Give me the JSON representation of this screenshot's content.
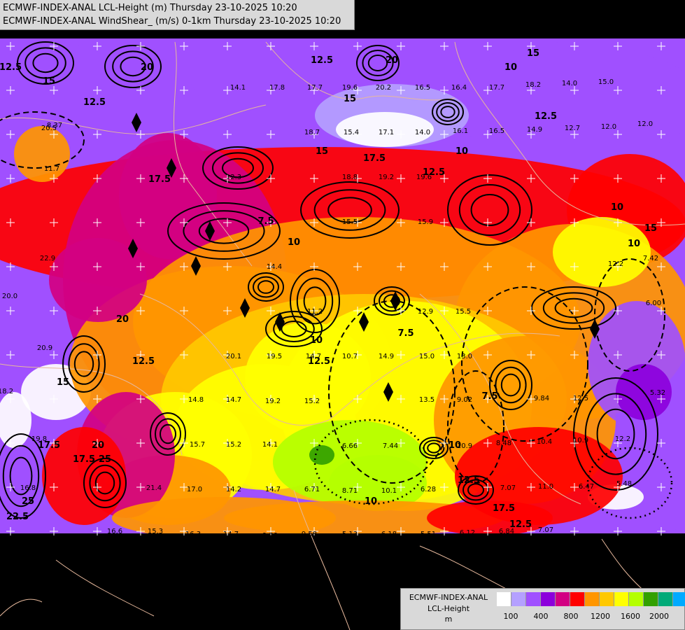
{
  "header": {
    "line1": "ECMWF-INDEX-ANAL LCL-Height (m) Thursday 23-10-2025 10:20",
    "line2": "ECMWF-INDEX-ANAL WindShear_ (m/s) 0-1km Thursday 23-10-2025 10:20"
  },
  "legend": {
    "line1": "ECMWF-INDEX-ANAL",
    "line2": "LCL-Height",
    "line3": "m",
    "colors": [
      "#ffffff",
      "#b4a0ff",
      "#a050ff",
      "#8c00dc",
      "#d20082",
      "#ff0000",
      "#ff9600",
      "#ffc800",
      "#ffff00",
      "#b4ff00",
      "#32a000",
      "#00aa78",
      "#00aaff"
    ],
    "tick_labels": [
      "100",
      "400",
      "800",
      "1200",
      "1600",
      "2000"
    ]
  },
  "contour_labels": {
    "wind_shear": [
      "12.5",
      "15",
      "12.5",
      "20",
      "17.5",
      "15",
      "17.5",
      "20",
      "12.5",
      "17.5",
      "12.5",
      "15",
      "17.5",
      "20",
      "15",
      "12.5",
      "10",
      "15",
      "10",
      "12.5",
      "15",
      "10",
      "10",
      "7.5",
      "10",
      "12.5",
      "10",
      "7.5",
      "10",
      "12.5",
      "7.5",
      "17.5",
      "12.5",
      "10",
      "25",
      "20",
      "25",
      "22.5"
    ]
  },
  "station_values": [
    "8.37",
    "14.1",
    "17.8",
    "17.7",
    "19.6",
    "20.2",
    "16.5",
    "16.4",
    "17.7",
    "18.2",
    "14.0",
    "15.0",
    "18.7",
    "15.4",
    "17.1",
    "14.0",
    "16.1",
    "16.5",
    "14.9",
    "12.7",
    "12.0",
    "12.0",
    "18.8",
    "19.2",
    "19.6",
    "15.5",
    "15.9",
    "14.4",
    "11.2",
    "12.9",
    "15.5",
    "20.1",
    "19.5",
    "14.7",
    "10.7",
    "14.9",
    "15.0",
    "13.0",
    "7.42",
    "6.00",
    "14.8",
    "14.7",
    "19.2",
    "15.2",
    "13.5",
    "9.02",
    "9.84",
    "12.2",
    "12.5",
    "6.66",
    "7.44",
    "10.9",
    "8.48",
    "10.4",
    "10.9",
    "5.32",
    "15.7",
    "15.2",
    "14.1",
    "8.71",
    "10.1",
    "6.28",
    "7.07",
    "11.0",
    "6.47",
    "5.48",
    "21.4",
    "17.0",
    "14.2",
    "14.7",
    "6.71",
    "16.6",
    "15.3",
    "16.3",
    "14.7",
    "9.30",
    "9.58",
    "5.13",
    "6.18",
    "5.51",
    "6.12",
    "6.84",
    "7.07",
    "12.2",
    "22.9",
    "20.0",
    "20.9",
    "18.2",
    "19.8",
    "16.8",
    "20.5",
    "11.7",
    "12.3"
  ]
}
